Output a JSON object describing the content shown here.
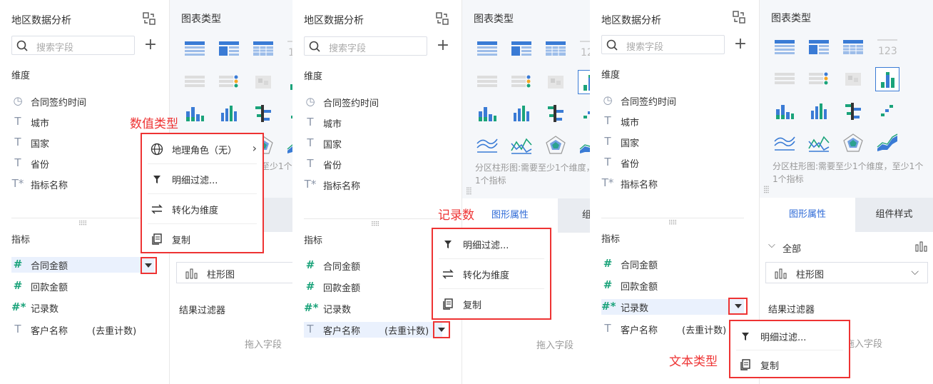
{
  "common": {
    "panel_title": "地区数据分析",
    "search_placeholder": "搜索字段",
    "plus": "+",
    "dimension_section": "维度",
    "measure_section": "指标",
    "chart_types_title": "图表类型",
    "dimensions": [
      {
        "icon": "clock-icon",
        "glyph": "◷",
        "label": "合同签约时间"
      },
      {
        "icon": "text-type-icon",
        "glyph": "T",
        "label": "城市"
      },
      {
        "icon": "text-type-icon",
        "glyph": "T",
        "label": "国家"
      },
      {
        "icon": "text-type-icon",
        "glyph": "T",
        "label": "省份"
      },
      {
        "icon": "text-type-icon",
        "glyph": "T*",
        "label": "指标名称"
      }
    ],
    "measures": [
      {
        "icon": "number-type-icon",
        "glyph": "#",
        "label": "合同金额",
        "sub": ""
      },
      {
        "icon": "number-type-icon",
        "glyph": "#",
        "label": "回款金额",
        "sub": ""
      },
      {
        "icon": "record-count-icon",
        "glyph": "#*",
        "label": "记录数",
        "sub": ""
      },
      {
        "icon": "text-type-icon",
        "glyph": "T",
        "label": "客户名称",
        "sub": "(去重计数)"
      }
    ],
    "tab_active": "图形属性",
    "tab_other": "组件样式",
    "all_label": "全部",
    "bar_chart": "柱形图",
    "result_filter": "结果过滤器",
    "drop_field": "拖入字段",
    "hint_line1": "分区柱形图:需要至少1个维度，至少1个",
    "hint_line2": "1个指标",
    "hint_short": "至少1个",
    "num_123": "123"
  },
  "menus": {
    "menu1": [
      "地理角色（无）",
      "明细过滤...",
      "转化为维度",
      "复制"
    ],
    "menu2": [
      "明细过滤...",
      "转化为维度",
      "复制"
    ],
    "menu3": [
      "明细过滤...",
      "复制"
    ]
  },
  "annotations": {
    "numeric_type": "数值类型",
    "record_count": "记录数",
    "text_type": "文本类型"
  },
  "colors": {
    "accent": "#2f6bd7",
    "annotation_red": "#ee3333",
    "number_green": "#1aa37a",
    "chart_blue": "#3a7bd5"
  }
}
